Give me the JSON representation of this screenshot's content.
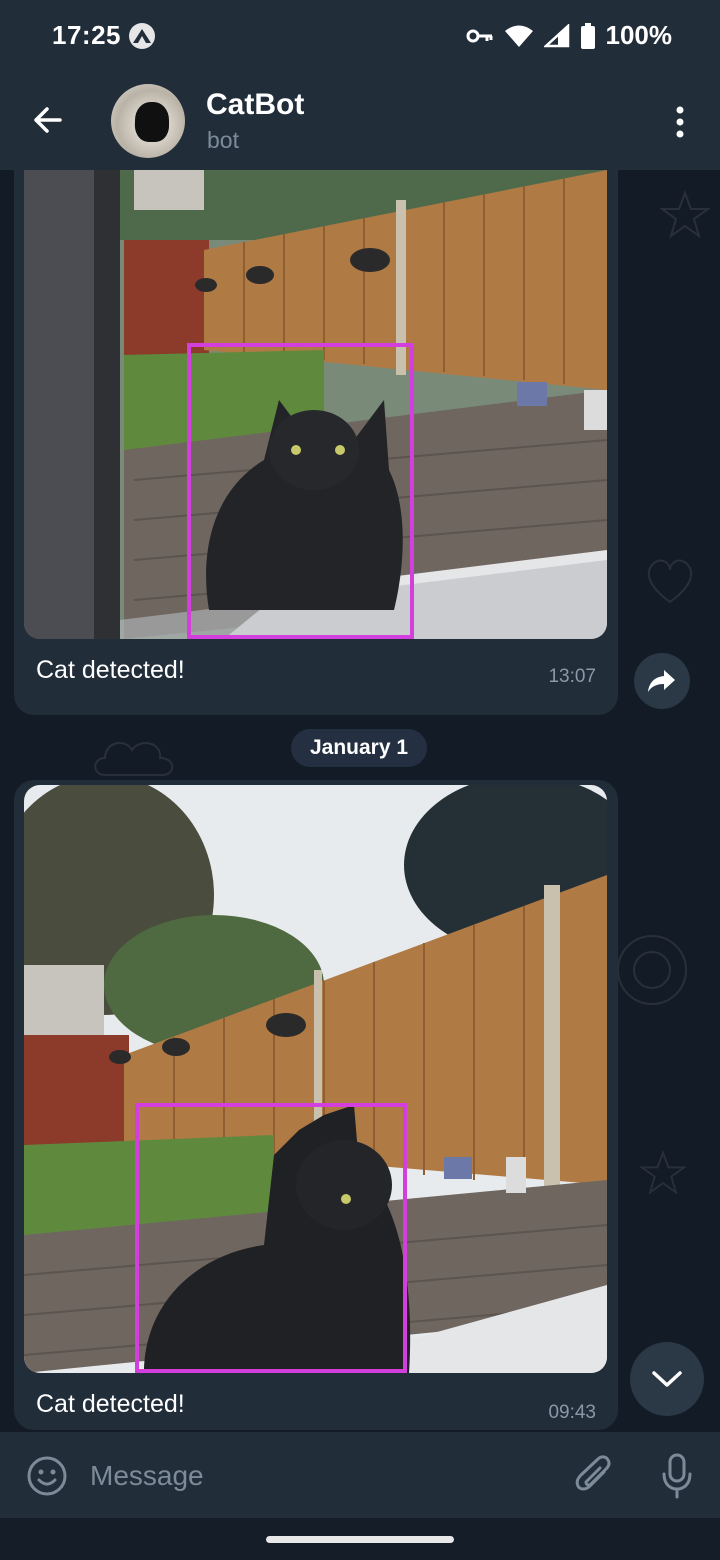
{
  "status_bar": {
    "time": "17:25",
    "battery": "100%",
    "icons": [
      "app-notification-icon",
      "vpn-key-icon",
      "wifi-icon",
      "cell-signal-icon",
      "battery-icon"
    ]
  },
  "header": {
    "title": "CatBot",
    "subtitle": "bot",
    "icons": [
      "back-arrow-icon",
      "more-vert-icon"
    ]
  },
  "messages": [
    {
      "caption": "Cat detected!",
      "time": "13:07"
    },
    {
      "caption": "Cat detected!",
      "time": "09:43"
    }
  ],
  "date_separator": "January 1",
  "composer": {
    "placeholder": "Message",
    "icons": [
      "emoji-icon",
      "attach-icon",
      "mic-icon"
    ]
  },
  "colors": {
    "background": "#131b26",
    "header": "#222d3a",
    "bubble": "#222d3a",
    "detection_box": "#d23fdc",
    "muted_text": "#7d8b99"
  }
}
